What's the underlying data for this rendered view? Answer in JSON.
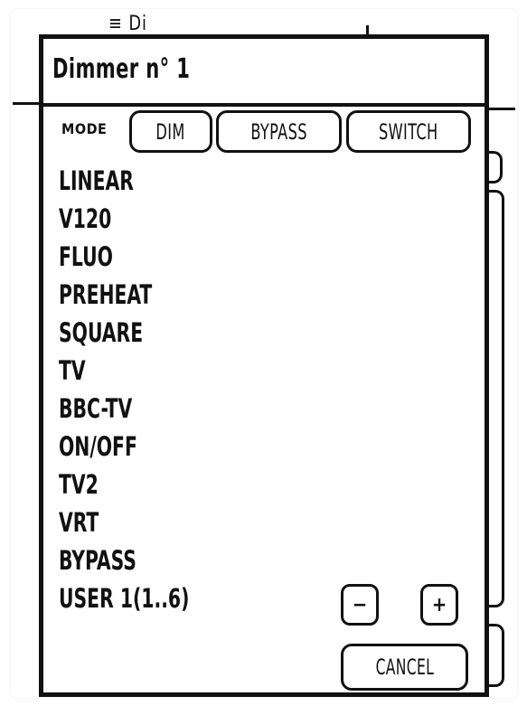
{
  "background": {
    "title_fragment": "≡ Di"
  },
  "dialog": {
    "title": "Dimmer n° 1",
    "mode": {
      "label": "MODE",
      "buttons": [
        "DIM",
        "BYPASS",
        "SWITCH"
      ]
    },
    "curves": [
      "LINEAR",
      "V120",
      "FLUO",
      "PREHEAT",
      "SQUARE",
      "TV",
      "BBC-TV",
      "ON/OFF",
      "TV2",
      "VRT",
      "BYPASS",
      "USER 1(1..6)"
    ],
    "minus_label": "−",
    "plus_label": "+",
    "cancel_label": "CANCEL"
  }
}
